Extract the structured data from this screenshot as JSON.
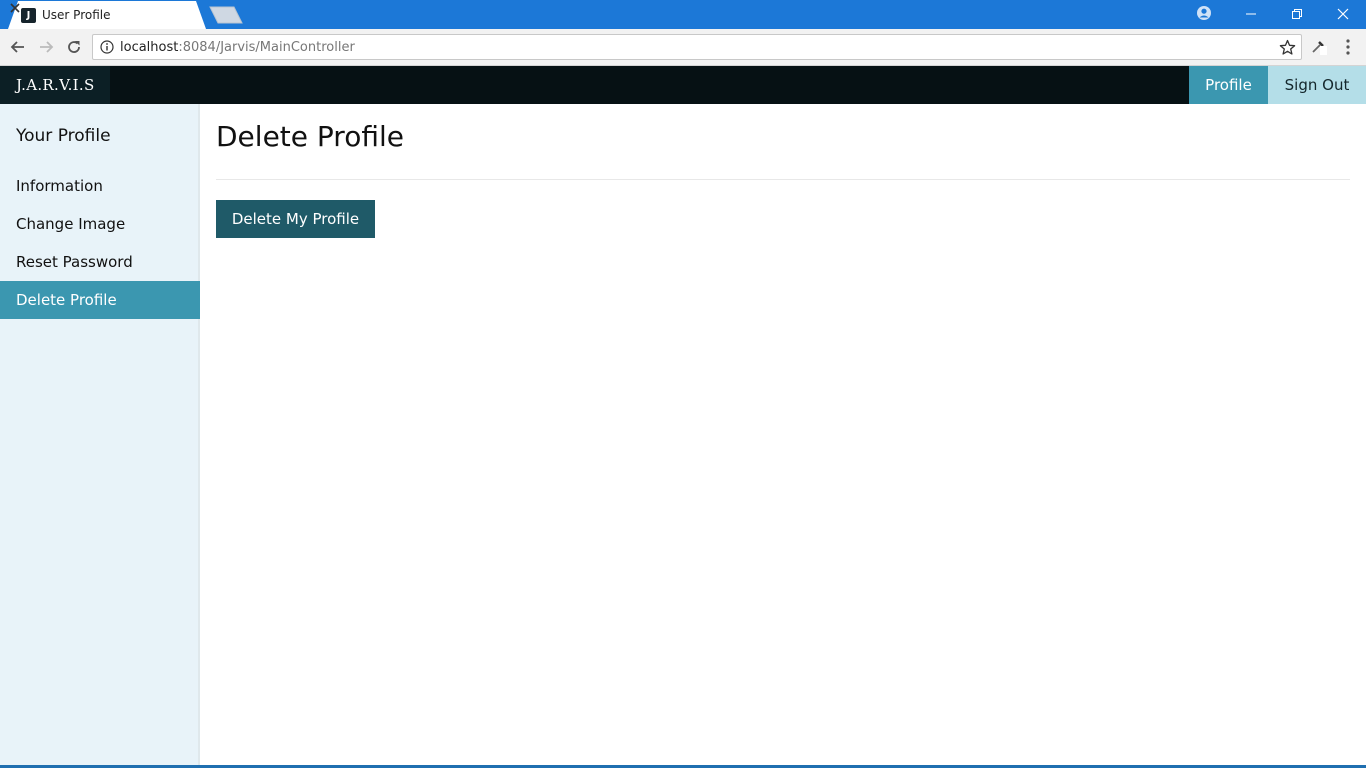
{
  "browser": {
    "tab_title": "User Profile",
    "favicon_letter": "J",
    "url_host": "localhost",
    "url_path": ":8084/Jarvis/MainController",
    "accent_color": "#1c78d7"
  },
  "navbar": {
    "brand": "J.A.R.V.I.S",
    "links": [
      {
        "label": "Profile",
        "active": true
      },
      {
        "label": "Sign Out",
        "active": false
      }
    ]
  },
  "sidebar": {
    "heading": "Your Profile",
    "items": [
      {
        "label": "Information",
        "active": false
      },
      {
        "label": "Change Image",
        "active": false
      },
      {
        "label": "Reset Password",
        "active": false
      },
      {
        "label": "Delete Profile",
        "active": true
      }
    ]
  },
  "main": {
    "title": "Delete Profile",
    "delete_button_label": "Delete My Profile"
  },
  "colors": {
    "active_item": "#3b97b0",
    "button": "#1f5a68",
    "sidebar_bg": "#e8f3f9",
    "navbar_bg": "#061114"
  }
}
